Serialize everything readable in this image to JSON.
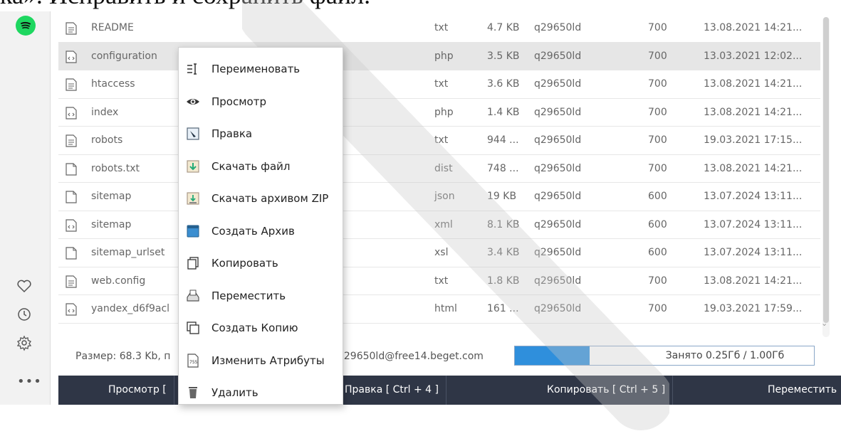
{
  "caption": "ка». Исправить и сохранить файл.",
  "files": [
    {
      "icon": "text-file-icon",
      "name": "README",
      "ext": "txt",
      "size": "4.7 KB",
      "owner": "q29650ld",
      "perm": "700",
      "date": "13.08.2021 14:21..."
    },
    {
      "icon": "code-file-icon",
      "name": "configuration",
      "ext": "php",
      "size": "3.5 KB",
      "owner": "q29650ld",
      "perm": "700",
      "date": "13.03.2021 12:02..."
    },
    {
      "icon": "text-file-icon",
      "name": "htaccess",
      "ext": "txt",
      "size": "3.6 KB",
      "owner": "q29650ld",
      "perm": "700",
      "date": "13.08.2021 14:21..."
    },
    {
      "icon": "code-file-icon",
      "name": "index",
      "ext": "php",
      "size": "1.4 KB",
      "owner": "q29650ld",
      "perm": "700",
      "date": "13.08.2021 14:21..."
    },
    {
      "icon": "text-file-icon",
      "name": "robots",
      "ext": "txt",
      "size": "944 ...",
      "owner": "q29650ld",
      "perm": "700",
      "date": "19.03.2021 17:15..."
    },
    {
      "icon": "blank-file-icon",
      "name": "robots.txt",
      "ext": "dist",
      "size": "748 ...",
      "owner": "q29650ld",
      "perm": "700",
      "date": "13.08.2021 14:21..."
    },
    {
      "icon": "blank-file-icon",
      "name": "sitemap",
      "ext": "json",
      "size": "19 KB",
      "owner": "q29650ld",
      "perm": "600",
      "date": "13.07.2024 13:11..."
    },
    {
      "icon": "code-file-icon",
      "name": "sitemap",
      "ext": "xml",
      "size": "8.1 KB",
      "owner": "q29650ld",
      "perm": "600",
      "date": "13.07.2024 13:11..."
    },
    {
      "icon": "blank-file-icon",
      "name": "sitemap_urlset",
      "ext": "xsl",
      "size": "3.4 KB",
      "owner": "q29650ld",
      "perm": "600",
      "date": "13.07.2024 13:11..."
    },
    {
      "icon": "text-file-icon",
      "name": "web.config",
      "ext": "txt",
      "size": "1.8 KB",
      "owner": "q29650ld",
      "perm": "700",
      "date": "13.08.2021 14:21..."
    },
    {
      "icon": "code-file-icon",
      "name": "yandex_d6f9acl",
      "ext": "html",
      "size": "161 ...",
      "owner": "q29650ld",
      "perm": "700",
      "date": "19.03.2021 17:59..."
    }
  ],
  "selected_row": 1,
  "context_menu": [
    {
      "icon": "rename-icon",
      "label": "Переименовать"
    },
    {
      "icon": "eye-icon",
      "label": "Просмотр"
    },
    {
      "icon": "edit-icon",
      "label": "Правка"
    },
    {
      "icon": "download-icon",
      "label": "Скачать файл"
    },
    {
      "icon": "zip-download-icon",
      "label": "Скачать архивом ZIP"
    },
    {
      "icon": "archive-icon",
      "label": "Создать Архив"
    },
    {
      "icon": "copy-icon",
      "label": "Копировать"
    },
    {
      "icon": "move-icon",
      "label": "Переместить"
    },
    {
      "icon": "duplicate-icon",
      "label": "Создать Копию"
    },
    {
      "icon": "attributes-icon",
      "label": "Изменить Атрибуты"
    },
    {
      "icon": "trash-icon",
      "label": "Удалить"
    }
  ],
  "status": {
    "size": "Размер: 68.3 Kb, п",
    "user": "q29650ld@free14.beget.com",
    "quota_label": "Занято 0.25Гб / 1.00Гб",
    "quota_fraction": 0.25
  },
  "bottom_bar": [
    {
      "label": "Просмотр ["
    },
    {
      "label": "Правка [ Ctrl + 4 ]"
    },
    {
      "label": "Копировать [ Ctrl + 5 ]"
    },
    {
      "label": "Переместить"
    }
  ],
  "sidebar_icons": [
    "spotify-logo-icon",
    "heart-icon",
    "clock-icon",
    "gear-icon",
    "more-icon"
  ],
  "colors": {
    "accent": "#2f8fdc",
    "bottom_bar": "#2f3646",
    "spotify": "#1ed760",
    "selected_row": "#e6e6e6"
  }
}
